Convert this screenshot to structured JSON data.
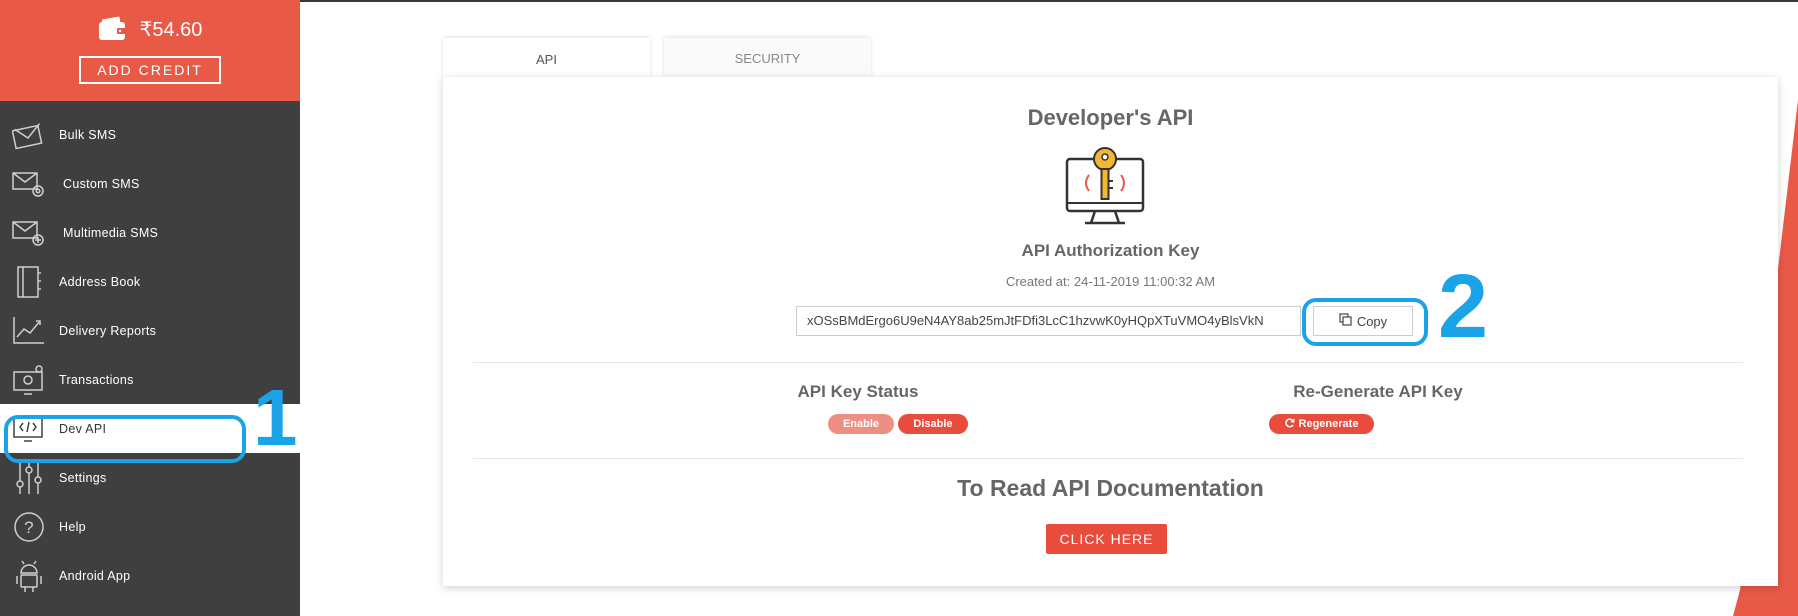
{
  "wallet": {
    "balance": "₹54.60",
    "add_credit_label": "ADD CREDIT"
  },
  "sidebar": {
    "items": [
      {
        "label": "Bulk SMS",
        "icon": "envelope-icon"
      },
      {
        "label": "Custom SMS",
        "icon": "envelope-gear-icon"
      },
      {
        "label": "Multimedia SMS",
        "icon": "envelope-plus-icon"
      },
      {
        "label": "Address Book",
        "icon": "address-book-icon"
      },
      {
        "label": "Delivery Reports",
        "icon": "chart-icon"
      },
      {
        "label": "Transactions",
        "icon": "monitor-money-icon"
      },
      {
        "label": "Dev API",
        "icon": "code-monitor-icon",
        "active": true
      },
      {
        "label": "Settings",
        "icon": "sliders-icon"
      },
      {
        "label": "Help",
        "icon": "question-icon"
      },
      {
        "label": "Android App",
        "icon": "android-icon"
      }
    ]
  },
  "tabs": [
    {
      "label": "API",
      "active": true
    },
    {
      "label": "SECURITY",
      "active": false
    }
  ],
  "card": {
    "title": "Developer's API",
    "subtitle": "API Authorization Key",
    "created": "Created at: 24-11-2019 11:00:32 AM",
    "api_key": "xOSsBMdErgo6U9eN4AY8ab25mJtFDfi3LcC1hzvwK0yHQpXTuVMO4yBlsVkN",
    "copy_label": "Copy",
    "status_title": "API Key Status",
    "enable_label": "Enable",
    "disable_label": "Disable",
    "regen_title": "Re-Generate API Key",
    "regen_label": "Regenerate",
    "doc_title": "To Read API Documentation",
    "click_here_label": "CLICK HERE"
  },
  "annotations": {
    "step1": "1",
    "step2": "2"
  },
  "colors": {
    "brand_red": "#e85a46",
    "sidebar_bg": "#3f3f3f",
    "annotation_blue": "#1aa3e6",
    "enable_pill": "#ee8f84",
    "disable_pill": "#e84c3d"
  }
}
